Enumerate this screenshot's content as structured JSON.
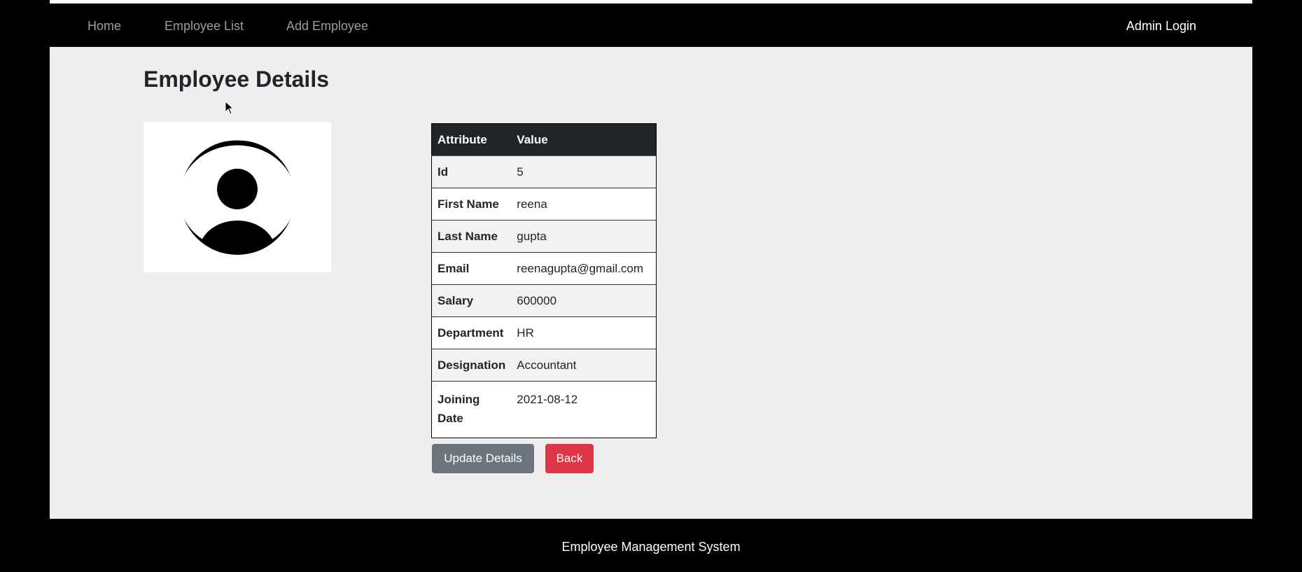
{
  "nav": {
    "home": "Home",
    "employee_list": "Employee List",
    "add_employee": "Add Employee",
    "admin_login": "Admin Login"
  },
  "page": {
    "title": "Employee Details"
  },
  "avatar": {
    "icon": "user-circle-icon"
  },
  "table": {
    "headers": [
      "Attribute",
      "Value"
    ],
    "rows": [
      {
        "attribute": "Id",
        "value": "5"
      },
      {
        "attribute": "First Name",
        "value": "reena"
      },
      {
        "attribute": "Last Name",
        "value": "gupta"
      },
      {
        "attribute": "Email",
        "value": "reenagupta@gmail.com"
      },
      {
        "attribute": "Salary",
        "value": "600000"
      },
      {
        "attribute": "Department",
        "value": "HR"
      },
      {
        "attribute": "Designation",
        "value": "Accountant"
      },
      {
        "attribute": "Joining Date",
        "value": "2021-08-12"
      }
    ]
  },
  "actions": {
    "update_label": "Update Details",
    "back_label": "Back"
  },
  "footer": {
    "text": "Employee Management System"
  },
  "colors": {
    "navbar": "#000000",
    "content_bg": "#efedee",
    "table_header": "#212529",
    "update_button": "#6c757d",
    "back_button": "#dc3545"
  }
}
